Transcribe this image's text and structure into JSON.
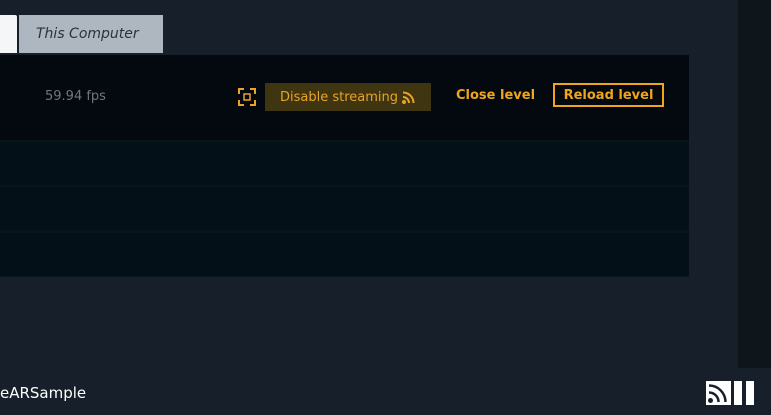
{
  "tabs": {
    "computer_label": "This Computer"
  },
  "level": {
    "fps": "59.94 fps",
    "disable_streaming_label": "Disable streaming",
    "close_label": "Close level",
    "reload_label": "Reload level"
  },
  "footer": {
    "project_name": "eARSample"
  },
  "icons": {
    "fullscreen": "fullscreen-icon",
    "rss": "rss-icon",
    "stream_status": "stream-status-icon",
    "pause": "pause-icon"
  },
  "colors": {
    "accent": "#f0a51c",
    "background": "#17202a",
    "panel": "#03090e"
  }
}
